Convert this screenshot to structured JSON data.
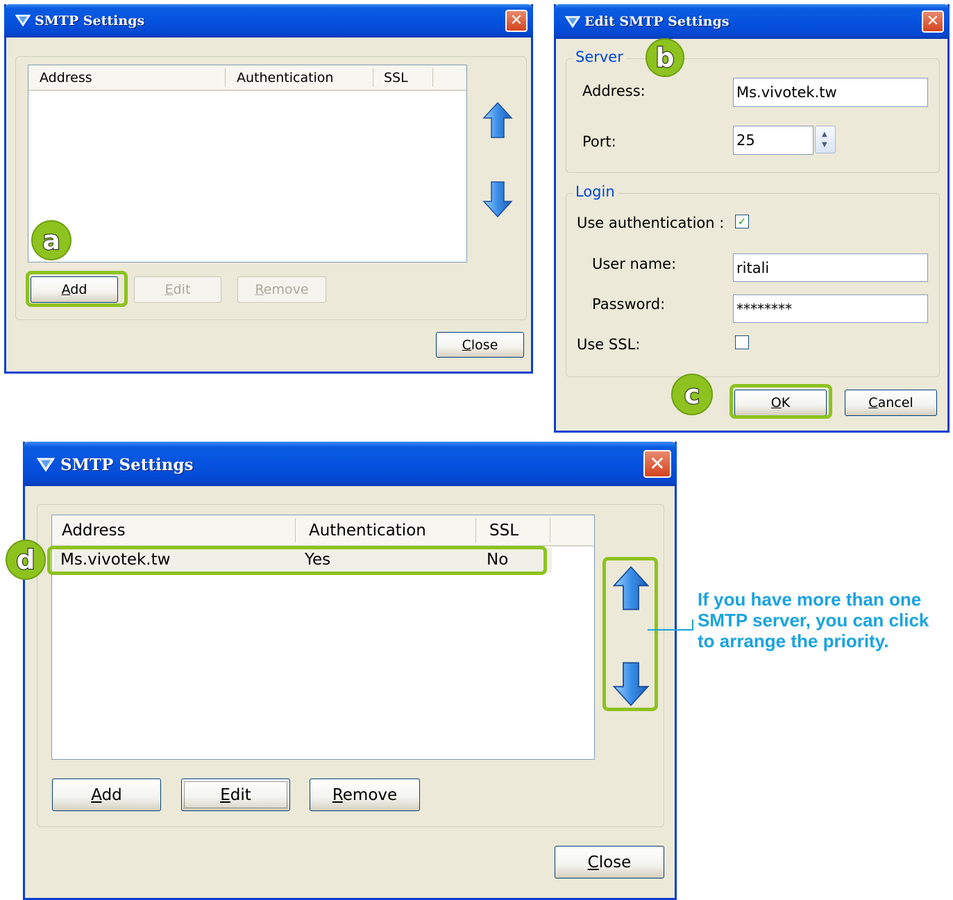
{
  "smtp_settings_empty": {
    "title": "SMTP Settings",
    "columns": [
      "Address",
      "Authentication",
      "SSL"
    ],
    "buttons": {
      "add": "Add",
      "edit": "Edit",
      "remove": "Remove",
      "close": "Close"
    },
    "callout": "a"
  },
  "edit_smtp_settings": {
    "title": "Edit SMTP Settings",
    "server_group": "Server",
    "address_label": "Address:",
    "address_value": "Ms.vivotek.tw",
    "port_label": "Port:",
    "port_value": "25",
    "login_group": "Login",
    "use_auth_label": "Use authentication :",
    "use_auth_checked": true,
    "username_label": "User name:",
    "username_value": "ritali",
    "password_label": "Password:",
    "password_value": "********",
    "use_ssl_label": "Use SSL:",
    "use_ssl_checked": false,
    "buttons": {
      "ok": "OK",
      "cancel": "Cancel"
    },
    "callouts": {
      "server": "b",
      "ok": "c"
    }
  },
  "smtp_settings_filled": {
    "title": "SMTP Settings",
    "columns": [
      "Address",
      "Authentication",
      "SSL"
    ],
    "rows": [
      {
        "address": "Ms.vivotek.tw",
        "authentication": "Yes",
        "ssl": "No"
      }
    ],
    "buttons": {
      "add": "Add",
      "edit": "Edit",
      "remove": "Remove",
      "close": "Close"
    },
    "callout": "d"
  },
  "annotation_note": "If you have more than one SMTP server, you can click to arrange the priority.",
  "colors": {
    "highlight_green": "#8dc21f",
    "title_blue": "#0553df",
    "note_blue": "#1aa3e0",
    "dialog_bg": "#ece9d8"
  },
  "icons": [
    "shield-icon",
    "close-icon",
    "arrow-up-icon",
    "arrow-down-icon",
    "checkmark-icon",
    "spin-up-icon",
    "spin-down-icon"
  ]
}
